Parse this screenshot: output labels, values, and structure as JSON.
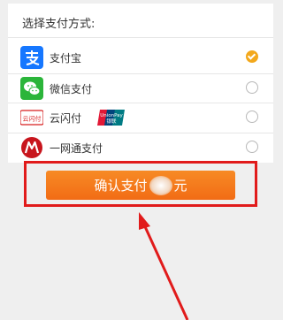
{
  "payment": {
    "title": "选择支付方式:",
    "methods": [
      {
        "label": "支付宝",
        "icon": "alipay-icon",
        "selected": true
      },
      {
        "label": "微信支付",
        "icon": "wechat-pay-icon",
        "selected": false
      },
      {
        "label": "云闪付",
        "icon": "cloud-quickpass-icon",
        "selected": false,
        "badge_icon": "unionpay-icon"
      },
      {
        "label": "一网通支付",
        "icon": "cmb-yiwangtong-icon",
        "selected": false
      }
    ],
    "icon_text": {
      "cloud_quickpass": "云闪付",
      "unionpay_top": "UnionPay",
      "unionpay_bottom": "银联"
    }
  },
  "confirm": {
    "prefix": "确认支付",
    "suffix": "元"
  },
  "colors": {
    "accent": "#f3a81c",
    "button": "#f26c15",
    "highlight": "#e11b1b",
    "alipay": "#1677ff",
    "wechat": "#2bb53a",
    "cmb": "#c8151d"
  }
}
